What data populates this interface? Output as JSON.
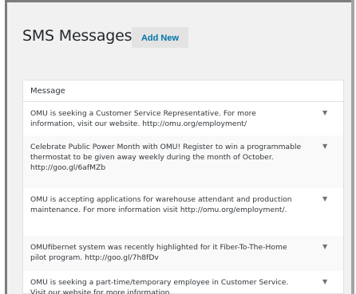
{
  "page": {
    "title": "SMS Messages",
    "add_new_label": "Add New"
  },
  "table": {
    "header": "Message",
    "toggle_glyph": "▼",
    "rows": [
      {
        "message": "OMU is seeking a Customer Service Representative. For more information, visit our website. http://omu.org/employment/"
      },
      {
        "message": "Celebrate Public Power Month with OMU! Register to win a programmable thermostat to be given away weekly during the month of October. http://goo.gl/6afMZb"
      },
      {
        "message": "OMU is accepting applications for warehouse attendant and production maintenance. For more information visit http://omu.org/employment/."
      },
      {
        "message": "OMUfibernet system was recently highlighted for it Fiber-To-The-Home pilot program. http://goo.gl/7h8fDv"
      },
      {
        "message": "OMU is seeking a part-time/temporary employee in Customer Service. Visit our website for more information."
      }
    ]
  }
}
